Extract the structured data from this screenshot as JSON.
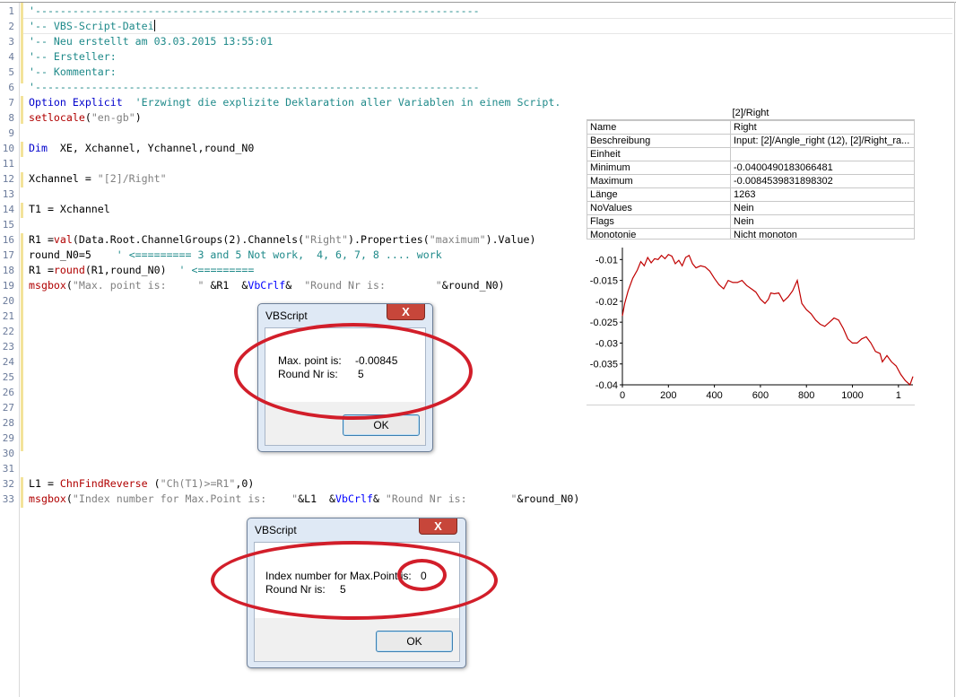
{
  "line_numbers": [
    "1",
    "2",
    "3",
    "4",
    "5",
    "6",
    "7",
    "8",
    "9",
    "10",
    "11",
    "12",
    "13",
    "14",
    "15",
    "16",
    "17",
    "18",
    "19",
    "20",
    "21",
    "22",
    "23",
    "24",
    "25",
    "26",
    "27",
    "28",
    "29",
    "30",
    "31",
    "32",
    "33"
  ],
  "code": {
    "l1": "'-----------------------------------------------------------------------",
    "l2": "'-- VBS-Script-Datei",
    "l3": "'-- Neu erstellt am 03.03.2015 13:55:01",
    "l4": "'-- Ersteller:",
    "l5": "'-- Kommentar:",
    "l6": "'-----------------------------------------------------------------------",
    "l7_kw": "Option Explicit",
    "l7_c": "  'Erzwingt die explizite Deklaration aller Variablen in einem Script.",
    "l8_fn": "setlocale",
    "l8_a": "(",
    "l8_s": "\"en-gb\"",
    "l8_b": ")",
    "l10_kw": "Dim",
    "l10_rest": "  XE, Xchannel, Ychannel,round_N0",
    "l12_a": "Xchannel = ",
    "l12_s": "\"[2]/Right\"",
    "l14": "T1 = Xchannel",
    "l16_a": "R1 =",
    "l16_fn": "val",
    "l16_b": "(Data.Root.ChannelGroups(2).Channels(",
    "l16_s1": "\"Right\"",
    "l16_c": ").Properties(",
    "l16_s2": "\"maximum\"",
    "l16_d": ").Value)",
    "l17_a": "round_N0=5",
    "l17_c": "    ' <========= 3 and 5 Not work,  4, 6, 7, 8 .... work",
    "l18_a": "R1 =",
    "l18_fn": "round",
    "l18_b": "(R1,round_N0)",
    "l18_c": "  ' <=========",
    "l19_fn": "msgbox",
    "l19_a": "(",
    "l19_s1": "\"Max. point is:     \"",
    "l19_b": " &R1  &",
    "l19_k": "VbCrlf",
    "l19_c": "&  ",
    "l19_s2": "\"Round Nr is:        \"",
    "l19_d": "&round_N0)",
    "l32_a": "L1 = ",
    "l32_fn": "ChnFindReverse",
    "l32_b": " (",
    "l32_s": "\"Ch(T1)>=R1\"",
    "l32_c": ",0)",
    "l33_fn": "msgbox",
    "l33_a": "(",
    "l33_s1": "\"Index number for Max.Point is:    \"",
    "l33_b": "&L1  &",
    "l33_k": "VbCrlf",
    "l33_c": "& ",
    "l33_s2": "\"Round Nr is:       \"",
    "l33_d": "&round_N0)"
  },
  "properties": {
    "header": "[2]/Right",
    "rows": [
      {
        "k": "Name",
        "v": "Right"
      },
      {
        "k": "Beschreibung",
        "v": "Input: [2]/Angle_right (12), [2]/Right_ra..."
      },
      {
        "k": "Einheit",
        "v": ""
      },
      {
        "k": "Minimum",
        "v": "-0.0400490183066481"
      },
      {
        "k": "Maximum",
        "v": "-0.0084539831898302"
      },
      {
        "k": "Länge",
        "v": "1263"
      },
      {
        "k": "NoValues",
        "v": "Nein"
      },
      {
        "k": "Flags",
        "v": "Nein"
      },
      {
        "k": "Monotonie",
        "v": "Nicht monoton"
      }
    ]
  },
  "chart_data": {
    "type": "line",
    "xlim": [
      0,
      1263
    ],
    "ylim": [
      -0.04,
      -0.008
    ],
    "xticks": [
      "0",
      "200",
      "400",
      "600",
      "800",
      "1000",
      "1"
    ],
    "yticks": [
      "-0.01",
      "-0.015",
      "-0.02",
      "-0.025",
      "-0.03",
      "-0.035",
      "-0.04"
    ],
    "ytick_values": [
      -0.01,
      -0.015,
      -0.02,
      -0.025,
      -0.03,
      -0.035,
      -0.04
    ],
    "xtick_values": [
      0,
      200,
      400,
      600,
      800,
      1000
    ],
    "line_color": "#c00000",
    "series": [
      {
        "x": [
          0,
          10,
          25,
          45,
          65,
          80,
          95,
          110,
          125,
          140,
          155,
          170,
          185,
          200,
          215,
          230,
          245,
          260,
          275,
          290,
          305,
          320,
          340,
          360,
          380,
          400,
          420,
          440,
          460,
          480,
          500,
          520,
          540,
          560,
          580,
          600,
          620,
          635,
          645,
          660,
          680,
          700,
          720,
          740,
          760,
          780,
          800,
          820,
          840,
          860,
          880,
          900,
          920,
          940,
          960,
          980,
          1000,
          1020,
          1040,
          1060,
          1080,
          1100,
          1120,
          1130,
          1150,
          1170,
          1190,
          1210,
          1230,
          1250,
          1263
        ],
        "y": [
          -0.0235,
          -0.0205,
          -0.0175,
          -0.0145,
          -0.0125,
          -0.0105,
          -0.0115,
          -0.0095,
          -0.0108,
          -0.0098,
          -0.01,
          -0.009,
          -0.0098,
          -0.0088,
          -0.0092,
          -0.011,
          -0.0102,
          -0.0115,
          -0.0095,
          -0.009,
          -0.011,
          -0.012,
          -0.0115,
          -0.0118,
          -0.0128,
          -0.0145,
          -0.016,
          -0.017,
          -0.015,
          -0.0155,
          -0.0155,
          -0.015,
          -0.0162,
          -0.017,
          -0.0178,
          -0.0195,
          -0.0205,
          -0.0195,
          -0.018,
          -0.0182,
          -0.018,
          -0.02,
          -0.019,
          -0.0175,
          -0.015,
          -0.0205,
          -0.022,
          -0.023,
          -0.0245,
          -0.0255,
          -0.026,
          -0.025,
          -0.024,
          -0.0245,
          -0.0265,
          -0.029,
          -0.03,
          -0.03,
          -0.029,
          -0.0285,
          -0.03,
          -0.032,
          -0.0325,
          -0.0345,
          -0.033,
          -0.0345,
          -0.0355,
          -0.0375,
          -0.039,
          -0.04,
          -0.038
        ]
      }
    ]
  },
  "dialog1": {
    "title": "VBScript",
    "close": "X",
    "line1_label": "Max. point is:",
    "line1_value": "-0.00845",
    "line2_label": "Round Nr is:",
    "line2_value": "5",
    "ok": "OK"
  },
  "dialog2": {
    "title": "VBScript",
    "close": "X",
    "line1_label": "Index number for Max.Point is:",
    "line1_value": "0",
    "line2_label": "Round Nr is:",
    "line2_value": "5",
    "ok": "OK"
  },
  "colors": {
    "annotation_red": "#d21e2a",
    "comment": "#1f8a8a",
    "keyword": "#0000cc",
    "function": "#b00000"
  }
}
